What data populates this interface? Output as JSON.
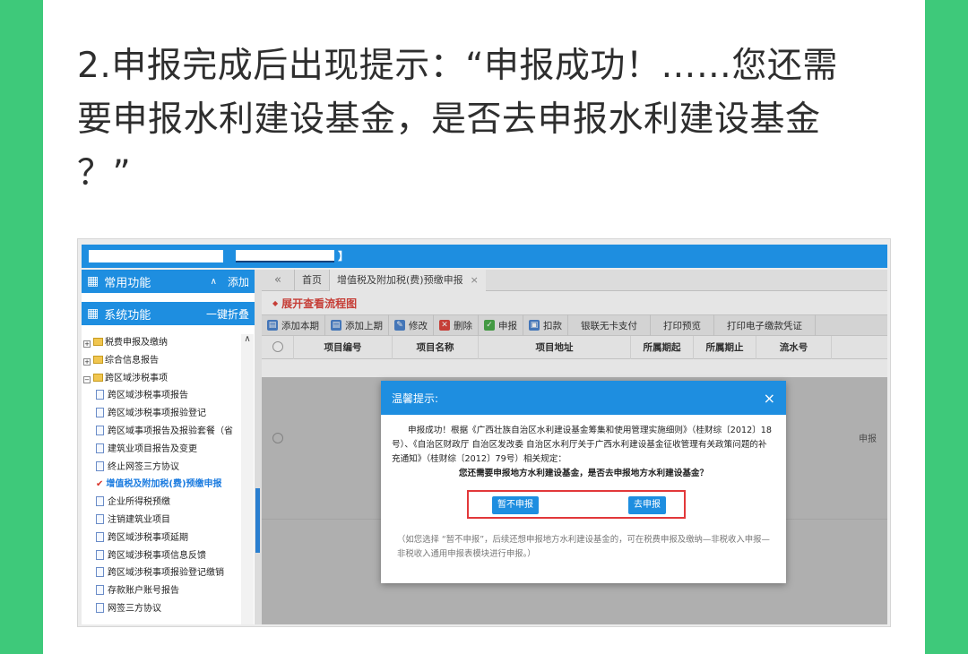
{
  "heading": {
    "line1": "2.申报完成后出现提示：“申报成功！……您还需",
    "line2": "要申报水利建设基金，是否去申报水利建设基金",
    "line3": "？”"
  },
  "topbar": {
    "bracket": "】"
  },
  "sidebar": {
    "common": {
      "label": "常用功能",
      "action": "添加"
    },
    "system": {
      "label": "系统功能",
      "action": "一键折叠"
    },
    "tree": [
      "税费申报及缴纳",
      "综合信息报告",
      "跨区域涉税事项",
      "跨区域涉税事项报告",
      "跨区域涉税事项报验登记",
      "跨区域事项报告及报验套餐（省",
      "建筑业项目报告及变更",
      "终止网签三方协议",
      "增值税及附加税(费)预缴申报",
      "企业所得税预缴",
      "注销建筑业项目",
      "跨区域涉税事项延期",
      "跨区域涉税事项信息反馈",
      "跨区域涉税事项报验登记缴销",
      "存款账户账号报告",
      "网签三方协议"
    ]
  },
  "tabs": {
    "nav": "«",
    "home": "首页",
    "current": "增值税及附加税(费)预缴申报",
    "close": "×"
  },
  "flow": {
    "label": "展开查看流程图"
  },
  "toolbar": {
    "add_current": "添加本期",
    "add_previous": "添加上期",
    "edit": "修改",
    "delete": "删除",
    "declare": "申报",
    "deduct": "扣款",
    "unionpay": "银联无卡支付",
    "print_preview": "打印预览",
    "print_e": "打印电子缴款凭证"
  },
  "grid": {
    "headers": [
      "项目编号",
      "项目名称",
      "项目地址",
      "所属期起",
      "所属期止",
      "流水号"
    ],
    "row_tag": "申报"
  },
  "dialog": {
    "title": "温馨提示:",
    "close": "×",
    "message": "申报成功！根据《广西壮族自治区水利建设基金筹集和使用管理实施细则》（桂财综〔2012〕18号）、《自治区财政厅 自治区发改委 自治区水利厅关于广西水利建设基金征收管理有关政策问题的补充通知》（桂财综〔2012〕79号）相关规定：",
    "question": "您还需要申报地方水利建设基金，是否去申报地方水利建设基金？",
    "btn_no": "暂不申报",
    "btn_yes": "去申报",
    "note": "（如您选择 “暂不申报”，后续还想申报地方水利建设基金的，可在税费申报及缴纳—非税收入申报—非税收入通用申报表模块进行申报。）"
  },
  "colors": {
    "page_bg": "#3ec97a",
    "app_blue": "#1e8ee0",
    "highlight_red": "#e2383a"
  }
}
